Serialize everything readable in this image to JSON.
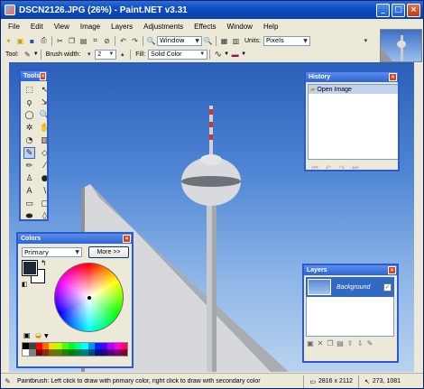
{
  "window": {
    "title": "DSCN2126.JPG (26%) - Paint.NET v3.31",
    "min": "_",
    "max": "□",
    "close": "×"
  },
  "menu": [
    "File",
    "Edit",
    "View",
    "Image",
    "Layers",
    "Adjustments",
    "Effects",
    "Window",
    "Help"
  ],
  "toolbar": {
    "zoom_label": "Window",
    "units_label": "Units:",
    "units_value": "Pixels",
    "tool_label": "Tool:",
    "brush_label": "Brush width:",
    "brush_value": "2",
    "fill_label": "Fill:",
    "fill_value": "Solid Color"
  },
  "tools_panel": {
    "title": "Tools",
    "tools": [
      {
        "name": "rectangle-select-icon",
        "glyph": "⬚"
      },
      {
        "name": "move-selection-icon",
        "glyph": "↖"
      },
      {
        "name": "lasso-select-icon",
        "glyph": "ϙ"
      },
      {
        "name": "move-selected-icon",
        "glyph": "⇲"
      },
      {
        "name": "ellipse-select-icon",
        "glyph": "◯"
      },
      {
        "name": "zoom-icon",
        "glyph": "🔍"
      },
      {
        "name": "magic-wand-icon",
        "glyph": "✲"
      },
      {
        "name": "pan-icon",
        "glyph": "✋"
      },
      {
        "name": "paint-bucket-icon",
        "glyph": "◔"
      },
      {
        "name": "gradient-icon",
        "glyph": "▥"
      },
      {
        "name": "paintbrush-icon",
        "glyph": "✎"
      },
      {
        "name": "eraser-icon",
        "glyph": "◇"
      },
      {
        "name": "pencil-icon",
        "glyph": "✏"
      },
      {
        "name": "color-picker-icon",
        "glyph": "⁄"
      },
      {
        "name": "clone-stamp-icon",
        "glyph": "♙"
      },
      {
        "name": "recolor-icon",
        "glyph": "●"
      },
      {
        "name": "text-icon",
        "glyph": "A"
      },
      {
        "name": "line-curve-icon",
        "glyph": "∖"
      },
      {
        "name": "rectangle-icon",
        "glyph": "▭"
      },
      {
        "name": "rounded-rectangle-icon",
        "glyph": "▢"
      },
      {
        "name": "ellipse-icon",
        "glyph": "⬬"
      },
      {
        "name": "freeform-shape-icon",
        "glyph": "◊"
      }
    ]
  },
  "history": {
    "title": "History",
    "items": [
      "Open Image"
    ]
  },
  "layers": {
    "title": "Layers",
    "items": [
      "Background"
    ]
  },
  "colors": {
    "title": "Colors",
    "mode": "Primary",
    "more_button": "More >>",
    "palette": [
      "#000000",
      "#404040",
      "#ff0000",
      "#ff6a00",
      "#ffd800",
      "#b6ff00",
      "#4cff00",
      "#00ff21",
      "#00ff90",
      "#00ffff",
      "#0094ff",
      "#0026ff",
      "#4800ff",
      "#b200ff",
      "#ff00dc",
      "#ff006e",
      "#ffffff",
      "#808080",
      "#7f0000",
      "#7f3300",
      "#7f6a00",
      "#5b7f00",
      "#267f00",
      "#007f0e",
      "#007f46",
      "#007f7f",
      "#004a7f",
      "#00137f",
      "#21007f",
      "#57007f",
      "#7f006e",
      "#7f0037"
    ]
  },
  "status": {
    "message": "Paintbrush: Left click to draw with primary color, right click to draw with secondary color",
    "size": "2816 x 2112",
    "position": "273, 1081"
  }
}
